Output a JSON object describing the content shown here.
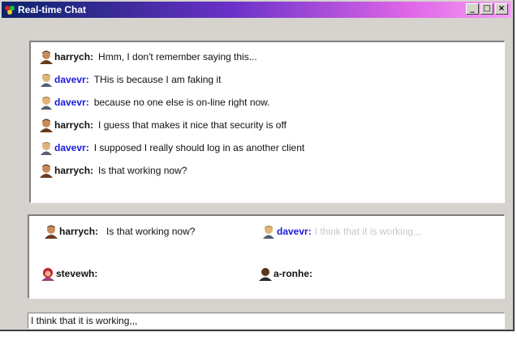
{
  "window": {
    "title": "Real-time Chat",
    "controls": [
      "minimize",
      "maximize",
      "close"
    ],
    "titlebar_colors": [
      "#0a246a",
      "#6a31c8",
      "#e066e8"
    ]
  },
  "chat_log": [
    {
      "user": "harrych:",
      "text": "Hmm, I don't remember saying this..."
    },
    {
      "user": "davevr:",
      "text": "THis is because I am faking it"
    },
    {
      "user": "davevr:",
      "text": "because no one else is on-line right now."
    },
    {
      "user": "harrych:",
      "text": "I guess that makes it nice that security is off"
    },
    {
      "user": "davevr:",
      "text": "I supposed I really should log in as another client"
    },
    {
      "user": "harrych:",
      "text": "Is that working now?"
    }
  ],
  "presence": [
    {
      "user": "harrych:",
      "typing": "Is that working now?"
    },
    {
      "user": "davevr:",
      "typing": "I think that it is working,,,"
    },
    {
      "user": "stevewh:",
      "typing": ""
    },
    {
      "user": "a-ronhe:",
      "typing": ""
    }
  ],
  "input": {
    "value": "I think that it is working,,,"
  },
  "colors": {
    "davevr_name": "#1a1adb",
    "faded_text": "#c8c8c8",
    "window_bg": "#d6d3ce"
  }
}
